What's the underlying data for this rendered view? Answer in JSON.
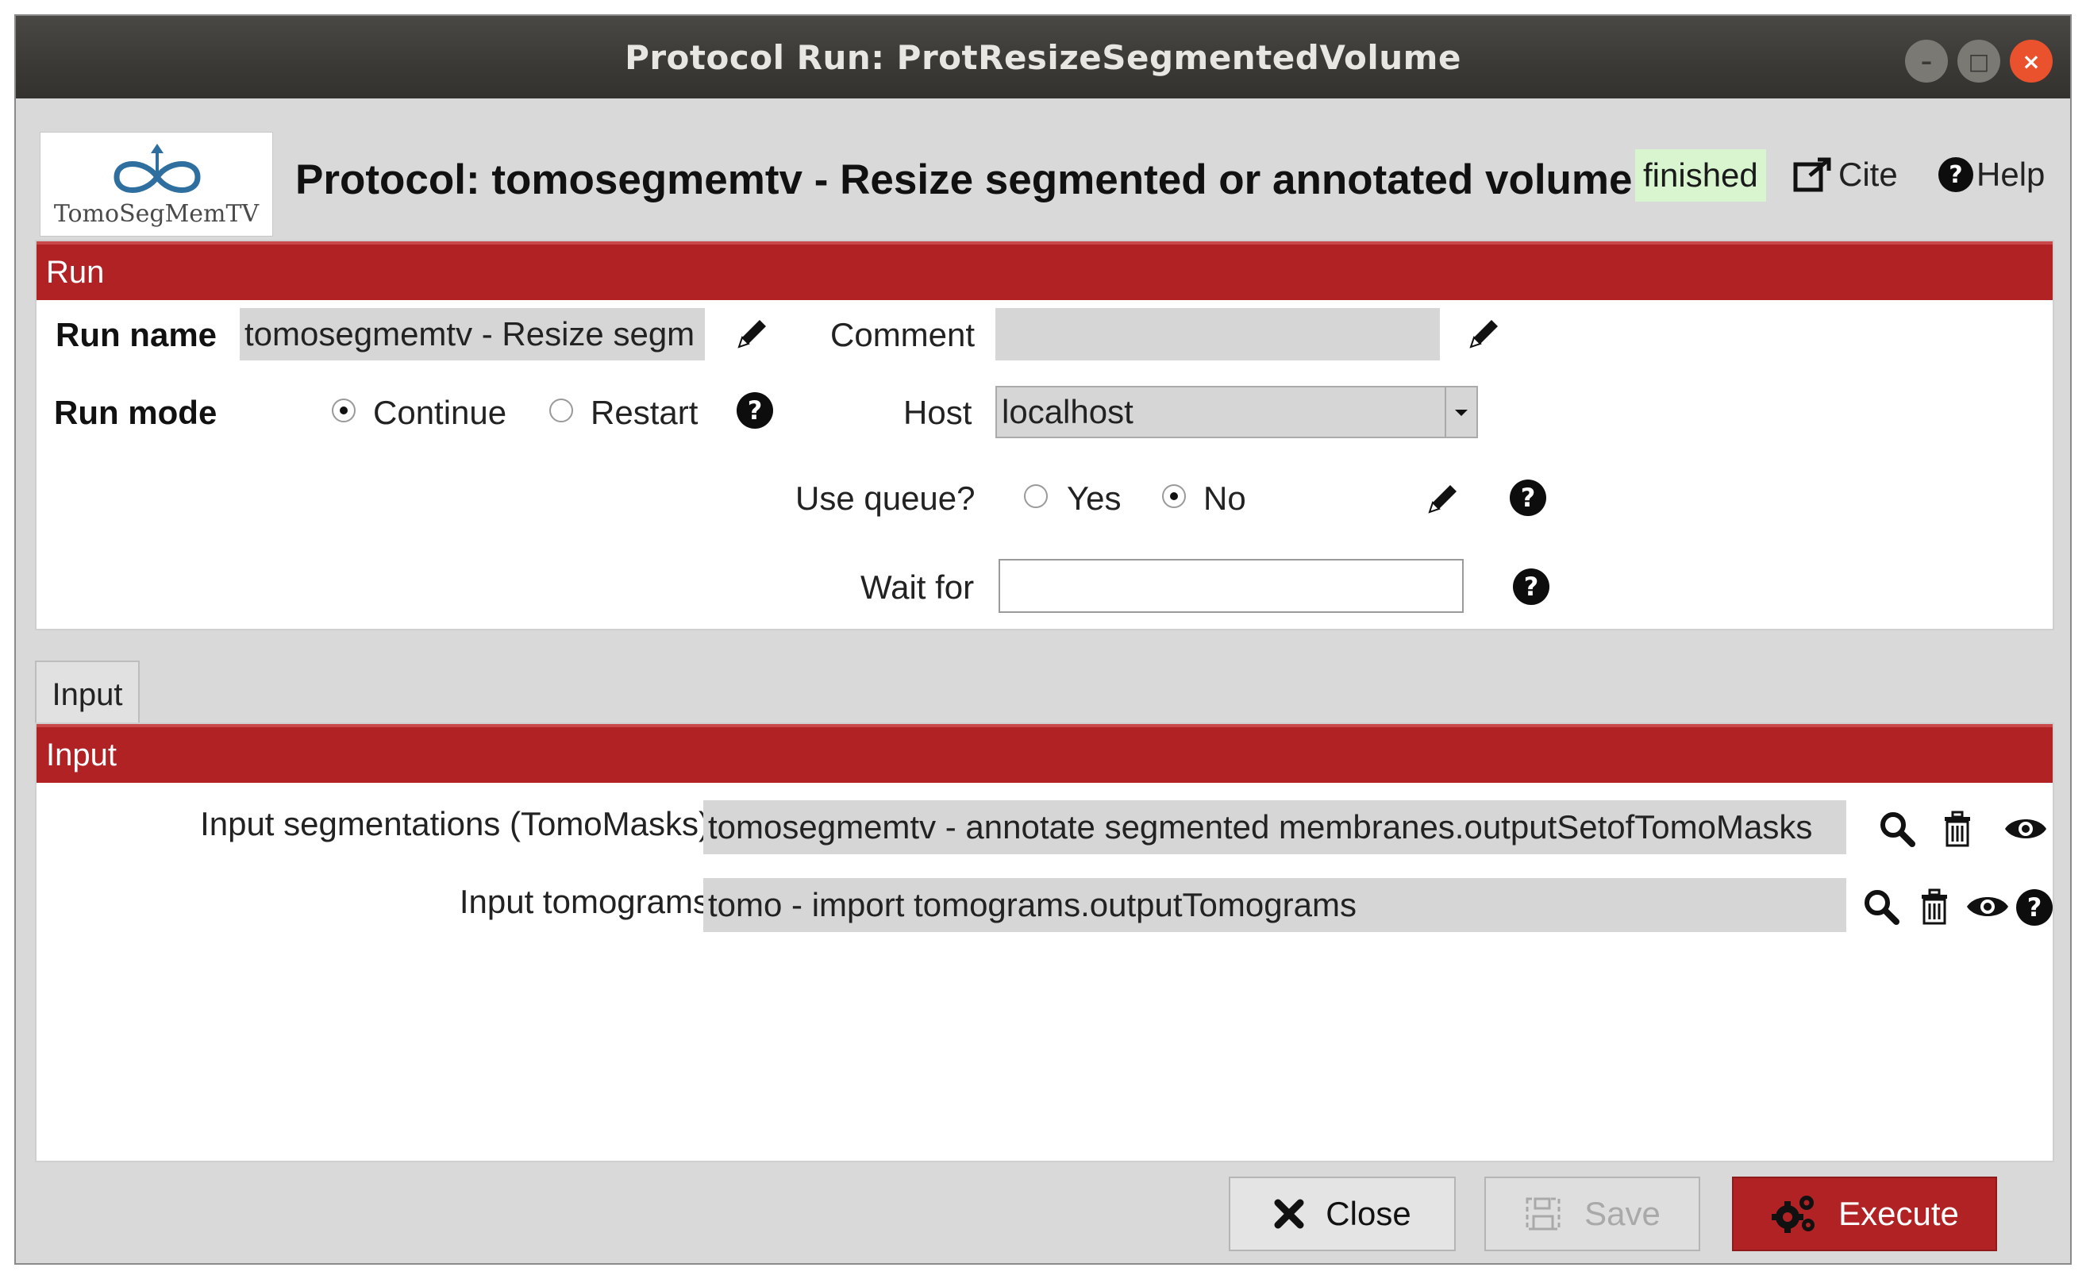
{
  "window": {
    "title": "Protocol Run: ProtResizeSegmentedVolume",
    "controls": [
      "minimize-icon",
      "maximize-icon",
      "close-icon"
    ]
  },
  "header": {
    "logo_text": "TomoSegMemTV",
    "protocol_title": "Protocol: tomosegmemtv - Resize segmented or annotated volume",
    "status": "finished",
    "cite_label": "Cite",
    "help_label": "Help"
  },
  "run_section": {
    "title": "Run",
    "run_name_label": "Run name",
    "run_name_value": "tomosegmemtv - Resize segm",
    "comment_label": "Comment",
    "comment_value": "",
    "run_mode_label": "Run mode",
    "run_mode_options": [
      "Continue",
      "Restart"
    ],
    "run_mode_selected": "Continue",
    "host_label": "Host",
    "host_value": "localhost",
    "use_queue_label": "Use queue?",
    "use_queue_options": [
      "Yes",
      "No"
    ],
    "use_queue_selected": "No",
    "wait_for_label": "Wait for",
    "wait_for_value": ""
  },
  "tabs": [
    {
      "label": "Input",
      "active": true
    }
  ],
  "input_section": {
    "title": "Input",
    "fields": [
      {
        "label": "Input segmentations (TomoMasks)",
        "value": "tomosegmemtv - annotate segmented membranes.outputSetofTomoMasks"
      },
      {
        "label": "Input tomograms",
        "value": "tomo - import tomograms.outputTomograms"
      }
    ]
  },
  "buttons": {
    "close": "Close",
    "save": "Save",
    "execute": "Execute"
  },
  "colors": {
    "section_header": "#b12225",
    "status_bg": "#d8f5cf",
    "execute_bg": "#b12225"
  }
}
